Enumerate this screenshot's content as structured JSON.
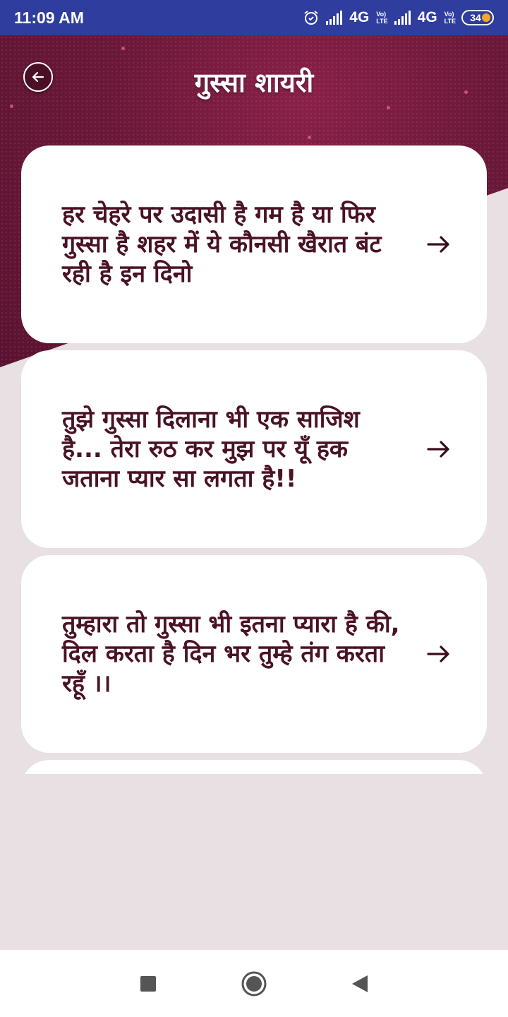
{
  "status_bar": {
    "time": "11:09 AM",
    "network1": "4G",
    "network2": "4G",
    "volte_top": "Vo)",
    "volte_bottom": "LTE",
    "battery": "34",
    "icons": [
      "alarm-icon",
      "signal-icon",
      "signal-icon",
      "battery-icon"
    ]
  },
  "header": {
    "title": "गुस्सा शायरी",
    "back_icon": "back-arrow-icon"
  },
  "cards": [
    {
      "text": "हर चेहरे पर उदासी है गम है या फिर गुस्सा है शहर में ये कौनसी खैरात बंट रही है इन दिनो"
    },
    {
      "text": "तुझे गुस्सा दिलाना भी एक साजिश है... तेरा रुठ कर मुझ पर यूँ हक जताना प्यार सा लगता है!!"
    },
    {
      "text": "तुम्हारा तो गुस्सा भी इतना प्यारा है की, दिल करता है दिन भर तुम्हे तंग करता रहूँ ।।"
    },
    {
      "text": ""
    }
  ],
  "nav": {
    "icons": [
      "recent-apps-icon",
      "home-icon",
      "back-icon"
    ]
  },
  "colors": {
    "status_bar": "#2f3e9e",
    "header": "#6b1838",
    "card_text": "#4a1226",
    "background": "#e8e0e2"
  }
}
